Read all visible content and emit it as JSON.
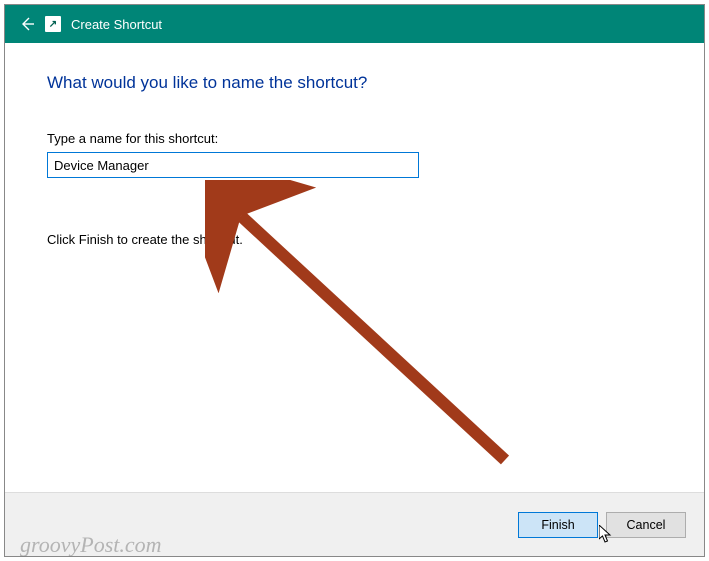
{
  "titlebar": {
    "title": "Create Shortcut"
  },
  "content": {
    "heading": "What would you like to name the shortcut?",
    "input_label": "Type a name for this shortcut:",
    "input_value": "Device Manager",
    "help_text": "Click Finish to create the shortcut."
  },
  "footer": {
    "finish_label": "Finish",
    "cancel_label": "Cancel"
  },
  "watermark": "groovyPost.com",
  "colors": {
    "titlebar_bg": "#008577",
    "heading_color": "#003399",
    "accent": "#0078d7",
    "arrow_annotation": "#a13a1a"
  }
}
